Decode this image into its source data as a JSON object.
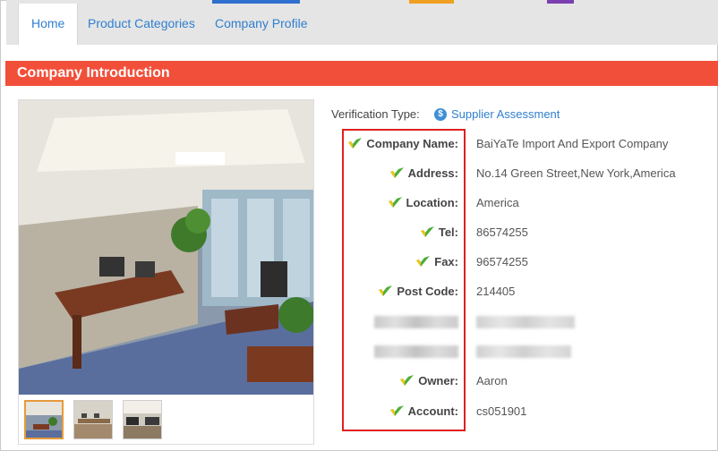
{
  "nav": {
    "tabs": [
      {
        "label": "Home"
      },
      {
        "label": "Product Categories"
      },
      {
        "label": "Company Profile"
      }
    ]
  },
  "section": {
    "title": "Company Introduction"
  },
  "verification": {
    "label": "Verification Type:",
    "value": "Supplier Assessment",
    "icon": "supplier-assessment-icon"
  },
  "details": [
    {
      "label": "Company Name:",
      "value": "BaiYaTe Import And Export Company"
    },
    {
      "label": "Address:",
      "value": "No.14 Green Street,New York,America"
    },
    {
      "label": "Location:",
      "value": "America"
    },
    {
      "label": "Tel:",
      "value": "86574255"
    },
    {
      "label": "Fax:",
      "value": "96574255"
    },
    {
      "label": "Post Code:",
      "value": "214405"
    },
    {
      "label": "Owner:",
      "value": "Aaron"
    },
    {
      "label": "Account:",
      "value": "cs051901"
    }
  ],
  "colors": {
    "accent": "#f24f3a",
    "link": "#2f7fcf",
    "highlight": "#e02020",
    "check_green": "#4cae3a"
  }
}
